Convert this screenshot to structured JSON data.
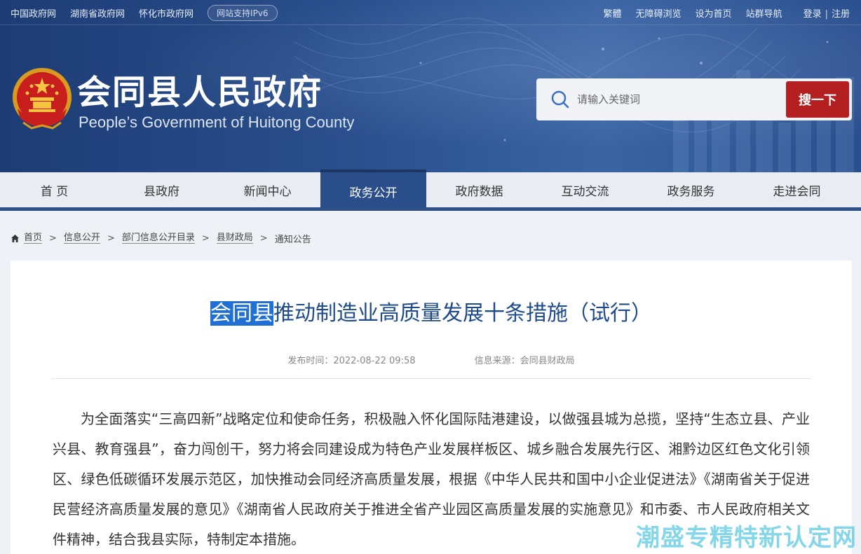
{
  "topbar": {
    "links_left": [
      "中国政府网",
      "湖南省政府网",
      "怀化市政府网"
    ],
    "ipv6_badge": "网站支持IPv6",
    "links_right": [
      "繁體",
      "无障碍浏览",
      "设为首页",
      "站群导航"
    ],
    "login": "登录",
    "login_sep": "|",
    "register": "注册"
  },
  "header": {
    "title": "会同县人民政府",
    "subtitle": "People’s Government of Huitong County"
  },
  "search": {
    "placeholder": "请输入关键词",
    "button_label": "搜一下"
  },
  "nav": {
    "items": [
      "首 页",
      "县政府",
      "新闻中心",
      "政务公开",
      "政府数据",
      "互动交流",
      "政务服务",
      "走进会同"
    ],
    "active_index": 3
  },
  "breadcrumb": {
    "items": [
      "首页",
      "信息公开",
      "部门信息公开目录",
      "县财政局",
      "通知公告"
    ],
    "sep": ">"
  },
  "article": {
    "title_highlight": "会同县",
    "title_rest": "推动制造业高质量发展十条措施（试行）",
    "publish_time": "发布时间：2022-08-22 09:58",
    "source": "信息来源：会同县财政局",
    "body": "为全面落实“三高四新”战略定位和使命任务，积极融入怀化国际陆港建设，以做强县城为总揽，坚持“生态立县、产业兴县、教育强县”，奋力闯创干，努力将会同建设成为特色产业发展样板区、城乡融合发展先行区、湘黔边区红色文化引领区、绿色低碳循环发展示范区，加快推动会同经济高质量发展，根据《中华人民共和国中小企业促进法》《湖南省关于促进民营经济高质量发展的意见》《湖南省人民政府关于推进全省产业园区高质量发展的实施意见》和市委、市人民政府相关文件精神，结合我县实际，特制定本措施。"
  },
  "watermark": "潮盛专精特新认定网",
  "colors": {
    "banner": "#2a4f8c",
    "nav_active": "#2a4e8a",
    "search_button": "#b41f1f",
    "title_text": "#1e4b8c",
    "highlight": "#1f6fd6",
    "watermark": "#6fd0e6"
  },
  "icons": [
    "national-emblem-icon",
    "search-icon",
    "home-icon"
  ]
}
